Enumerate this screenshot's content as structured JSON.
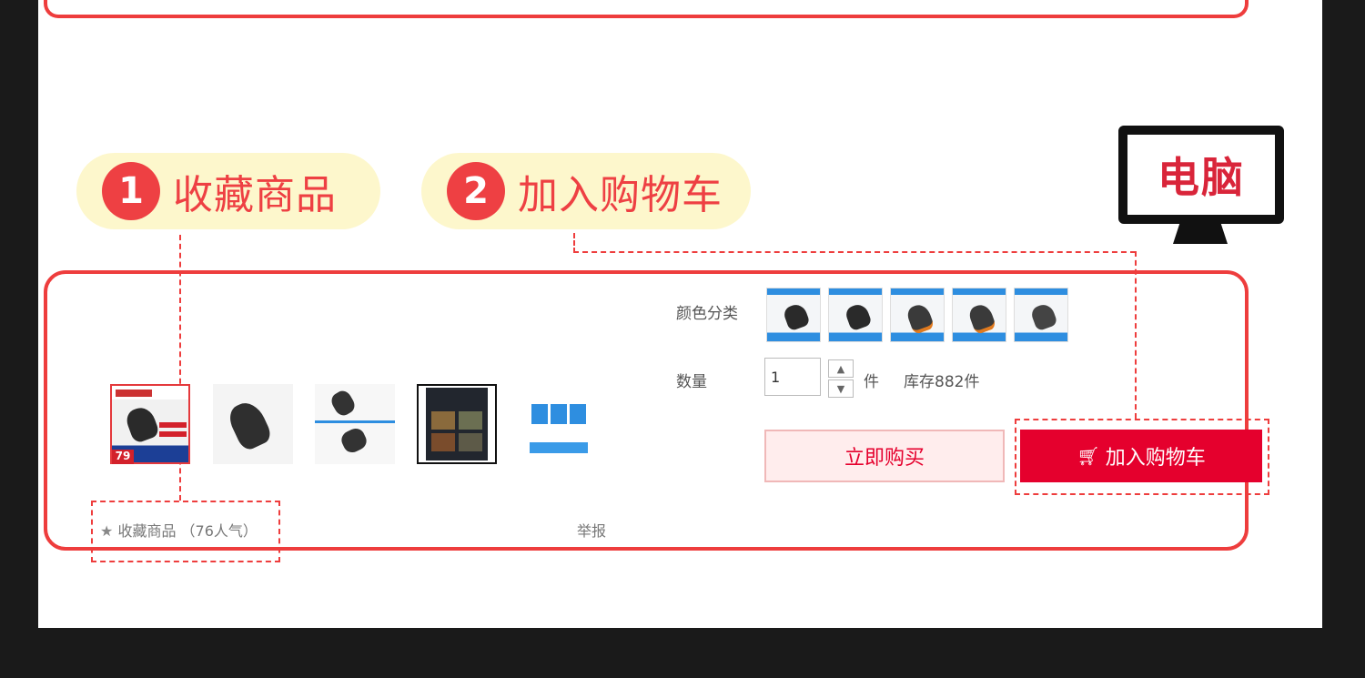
{
  "badges": [
    {
      "num": "1",
      "text": "收藏商品"
    },
    {
      "num": "2",
      "text": "加入购物车"
    }
  ],
  "monitor_label": "电脑",
  "product": {
    "color_label": "颜色分类",
    "qty_label": "数量",
    "qty_value": "1",
    "unit": "件",
    "stock": "库存882件",
    "buy_now": "立即购买",
    "add_cart": "加入购物车",
    "favorite": "收藏商品",
    "popularity": "（76人气）",
    "report": "举报",
    "thumb_price": "79"
  },
  "icons": {
    "cart": "cart-icon",
    "star": "star-icon",
    "up": "chevron-up-icon",
    "down": "chevron-down-icon"
  },
  "colors": {
    "accent": "#ee3d3d",
    "cart_button": "#e5002d",
    "pill_bg": "#fdf7cc"
  }
}
